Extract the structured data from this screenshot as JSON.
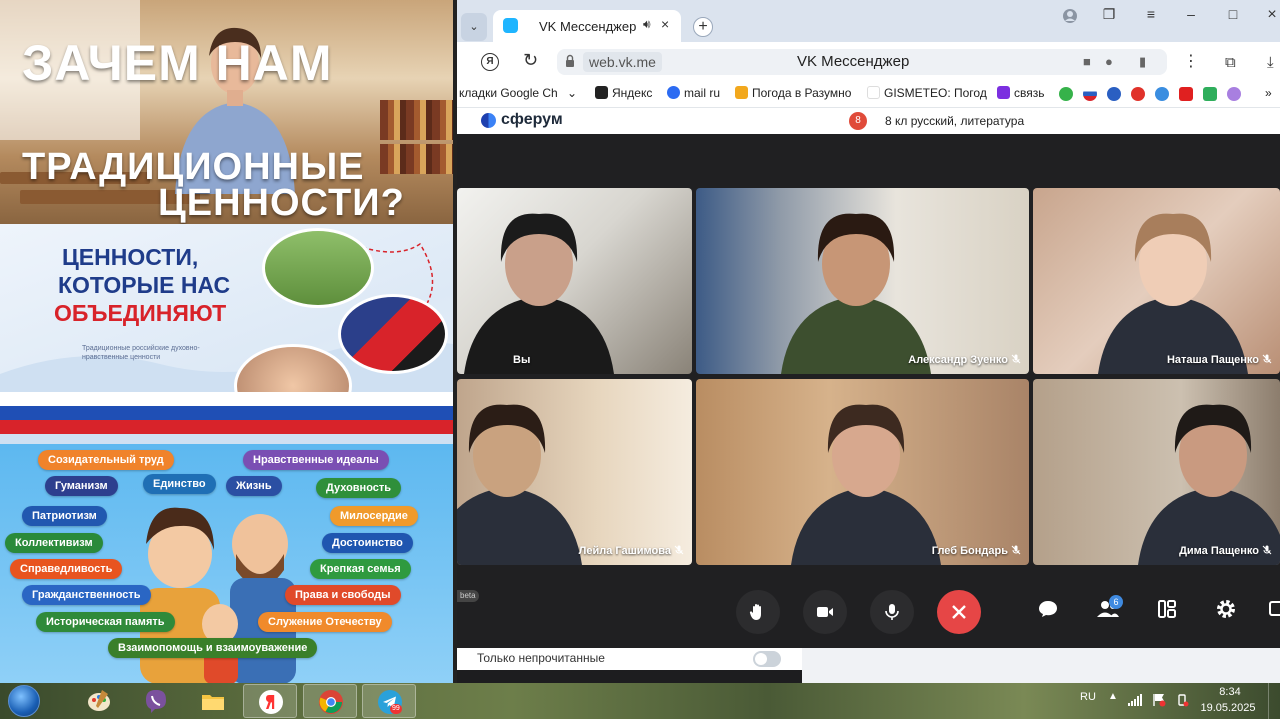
{
  "poster": {
    "title_line1": "ЗАЧЕМ НАМ",
    "title_line2": "ТРАДИЦИОННЫЕ",
    "title_line3": "ЦЕННОСТИ?",
    "mid_line1": "ЦЕННОСТИ,",
    "mid_line2": "КОТОРЫЕ НАС",
    "mid_line3": "ОБЪЕДИНЯЮТ",
    "mid_caption": "Традиционные российские духовно-нравственные ценности",
    "values": [
      {
        "label": "Созидательный труд",
        "color": "#f0832b"
      },
      {
        "label": "Нравственные идеалы",
        "color": "#7a4fb3"
      },
      {
        "label": "Гуманизм",
        "color": "#2d3f8e"
      },
      {
        "label": "Единство",
        "color": "#1f6fb5"
      },
      {
        "label": "Жизнь",
        "color": "#2b4fa3"
      },
      {
        "label": "Духовность",
        "color": "#2f8f3a"
      },
      {
        "label": "Патриотизм",
        "color": "#2158b0"
      },
      {
        "label": "Милосердие",
        "color": "#f09a2b"
      },
      {
        "label": "Коллективизм",
        "color": "#2a8a3a"
      },
      {
        "label": "Достоинство",
        "color": "#1f56b0"
      },
      {
        "label": "Справедливость",
        "color": "#e8541f"
      },
      {
        "label": "Крепкая семья",
        "color": "#2f9a3f"
      },
      {
        "label": "Гражданственность",
        "color": "#2a66c4"
      },
      {
        "label": "Права и свободы",
        "color": "#e04a2a"
      },
      {
        "label": "Историческая память",
        "color": "#2f8a3a"
      },
      {
        "label": "Служение Отечеству",
        "color": "#f08a2b"
      },
      {
        "label": "Взаимопомощь и взаимоуважение",
        "color": "#3a7f2a"
      }
    ]
  },
  "browser": {
    "tab_title": "VK Мессенджер",
    "url_host": "web.vk.me",
    "page_title": "VK Мессенджер",
    "bookmarks": [
      "кладки Google Ch",
      "Яндекс",
      "mail ru",
      "Погода в Разумно",
      "GISMETEO: Погод",
      "связь"
    ]
  },
  "vk": {
    "logo": "сферум",
    "chat_avatar": "8",
    "chat_title": "8 кл русский, литература",
    "beta": "beta",
    "participants_badge": "6",
    "unread_label": "Только непрочитанные",
    "participants": [
      {
        "name": "Вы",
        "muted": false
      },
      {
        "name": "Александр Зуенко",
        "muted": true
      },
      {
        "name": "Наташа Пащенко",
        "muted": true
      },
      {
        "name": "Лейла Гашимова",
        "muted": true
      },
      {
        "name": "Глеб Бондарь",
        "muted": true
      },
      {
        "name": "Дима Пащенко",
        "muted": true
      }
    ]
  },
  "taskbar": {
    "lang": "RU",
    "time": "8:34",
    "date": "19.05.2025",
    "telegram_badge": "99"
  }
}
